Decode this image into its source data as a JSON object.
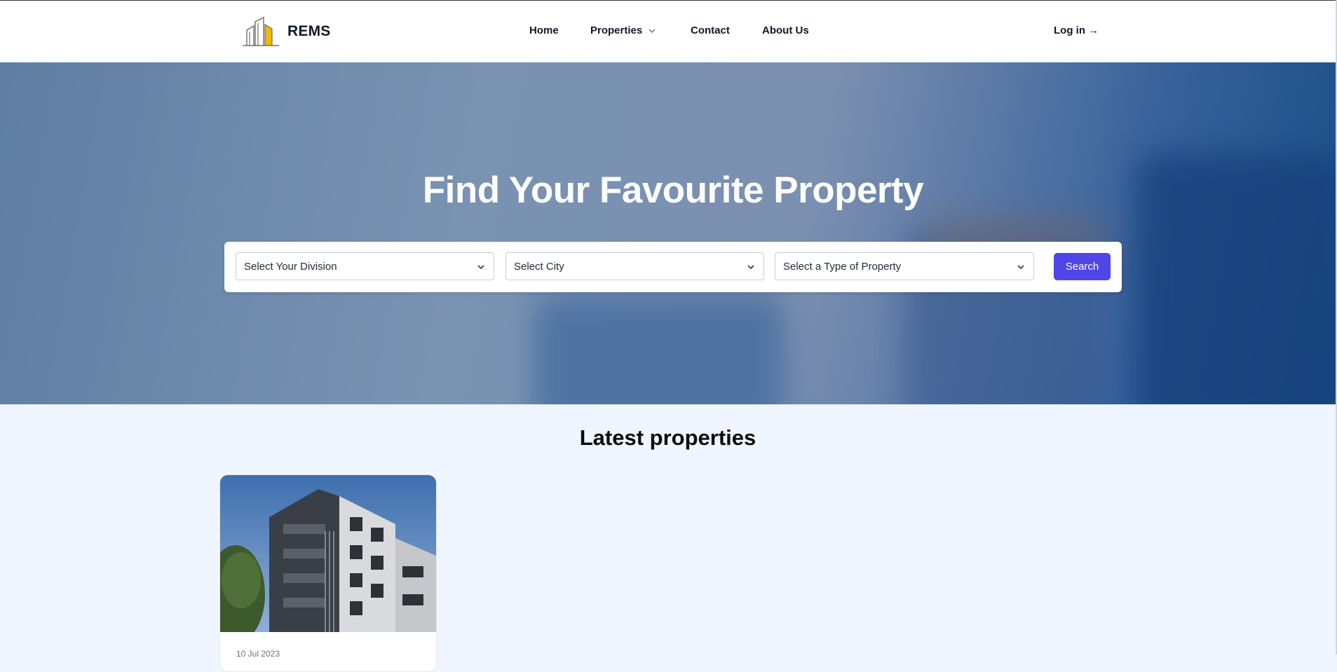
{
  "brand": {
    "name": "REMS",
    "logo_icon": "building-logo-icon",
    "accent": "#f5b800"
  },
  "nav": {
    "home": "Home",
    "properties": "Properties",
    "contact": "Contact",
    "about": "About Us",
    "login": "Log in →"
  },
  "hero": {
    "title": "Find Your Favourite Property",
    "division_select": "Select Your Division",
    "city_select": "Select City",
    "type_select": "Select a Type of Property",
    "search_button": "Search",
    "button_color": "#4f46e5"
  },
  "latest": {
    "title": "Latest properties",
    "cards": [
      {
        "date": "10 Jul 2023",
        "image_icon": "apartment-building-photo"
      }
    ]
  }
}
